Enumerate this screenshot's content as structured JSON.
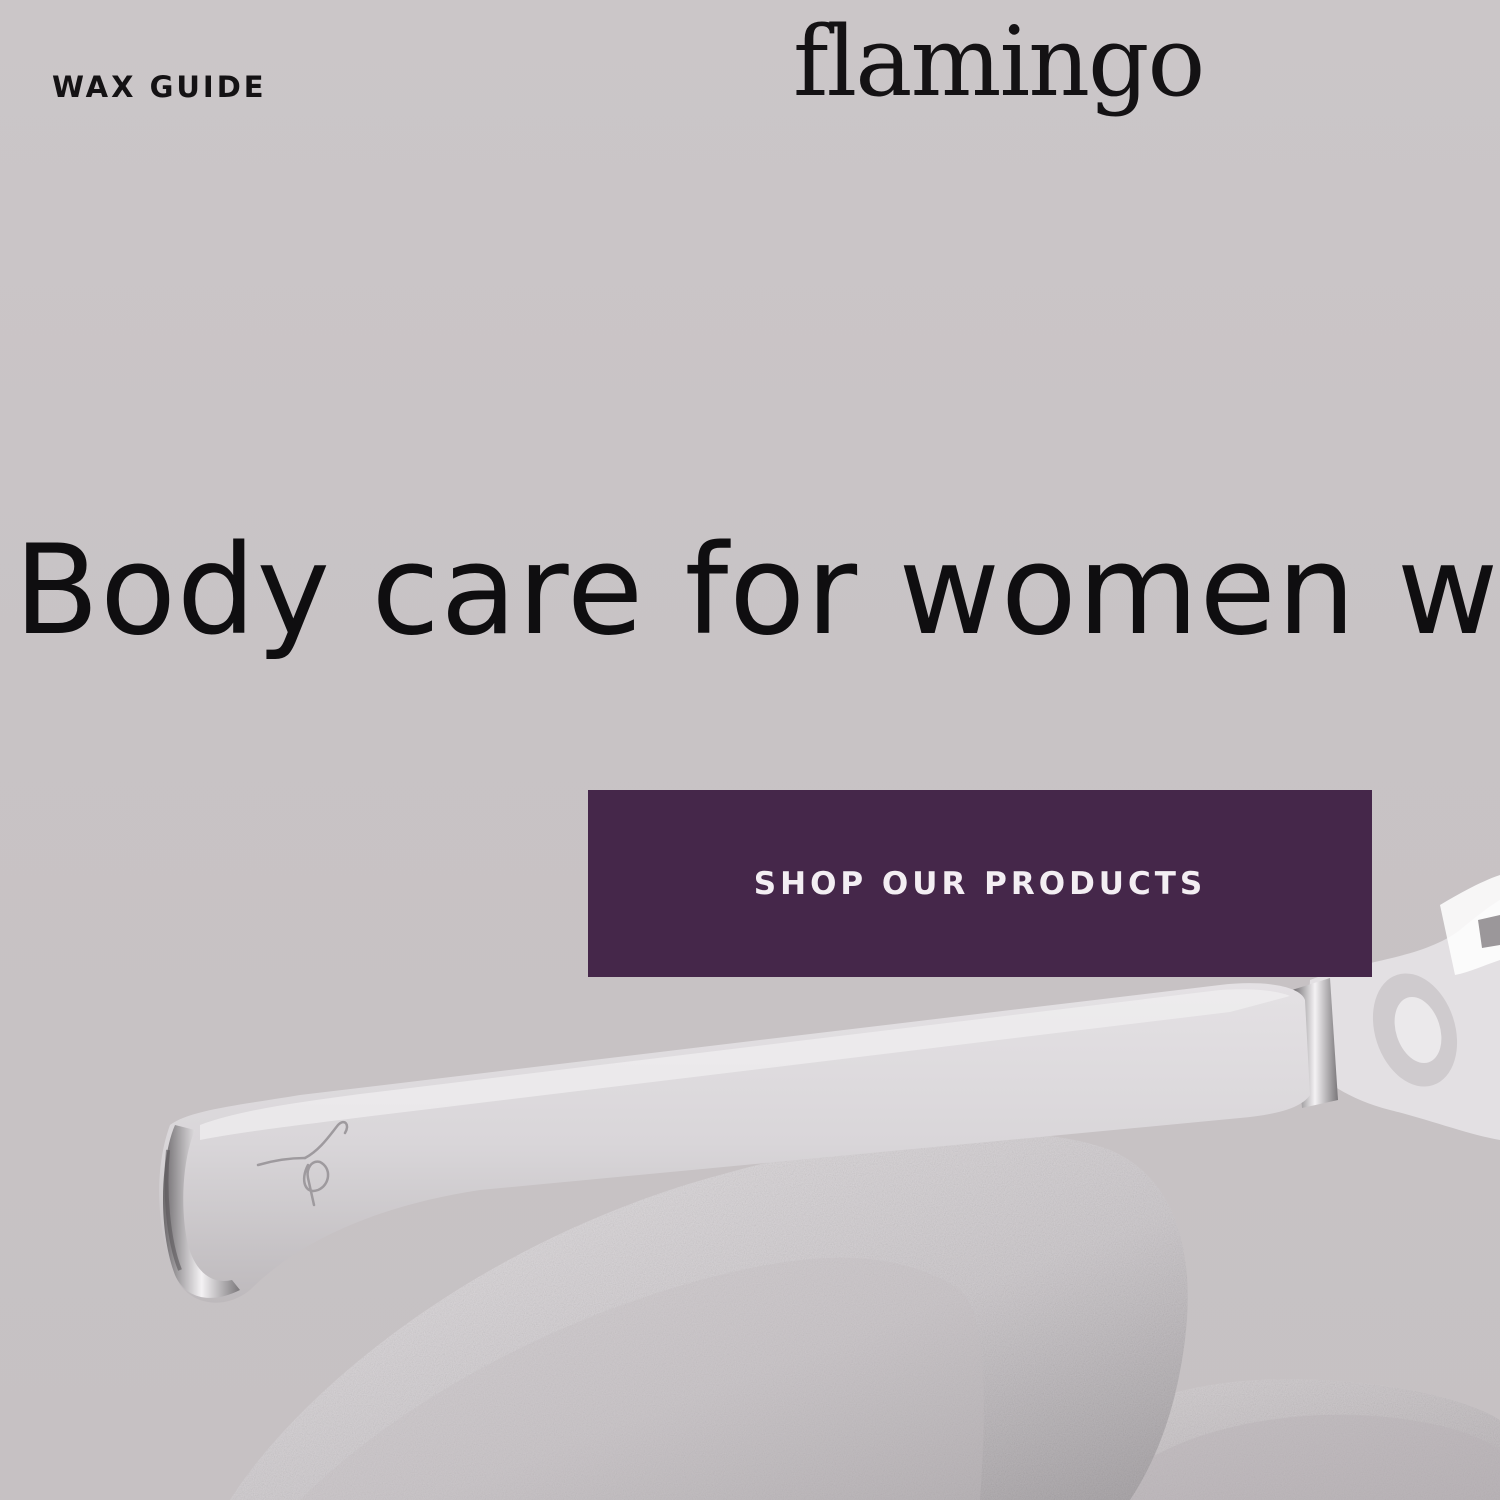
{
  "nav": {
    "wax_guide_label": "WAX GUIDE"
  },
  "brand": {
    "logo_text": "flamingo"
  },
  "hero": {
    "headline": "Body care for women w",
    "cta_label": "SHOP OUR PRODUCTS",
    "cta_color": "#45274a",
    "background_color": "#c9c4c6"
  },
  "icons": {
    "razor_logo_mark": "flamingo-monogram-icon"
  }
}
